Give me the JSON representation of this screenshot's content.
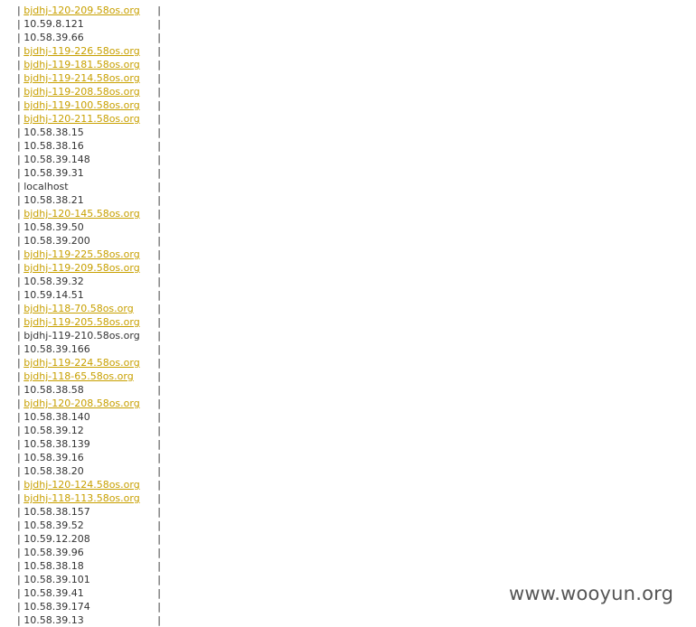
{
  "hosts": [
    {
      "name": "bjdhj-120-209.58os.org",
      "link": true
    },
    {
      "name": "10.59.8.121",
      "link": false
    },
    {
      "name": "10.58.39.66",
      "link": false
    },
    {
      "name": "bjdhj-119-226.58os.org",
      "link": true
    },
    {
      "name": "bjdhj-119-181.58os.org",
      "link": true
    },
    {
      "name": "bjdhj-119-214.58os.org",
      "link": true
    },
    {
      "name": "bjdhj-119-208.58os.org",
      "link": true
    },
    {
      "name": "bjdhj-119-100.58os.org",
      "link": true
    },
    {
      "name": "bjdhj-120-211.58os.org",
      "link": true
    },
    {
      "name": "10.58.38.15",
      "link": false
    },
    {
      "name": "10.58.38.16",
      "link": false
    },
    {
      "name": "10.58.39.148",
      "link": false
    },
    {
      "name": "10.58.39.31",
      "link": false
    },
    {
      "name": "localhost",
      "link": false
    },
    {
      "name": "10.58.38.21",
      "link": false
    },
    {
      "name": "bjdhj-120-145.58os.org",
      "link": true
    },
    {
      "name": "10.58.39.50",
      "link": false
    },
    {
      "name": "10.58.39.200",
      "link": false
    },
    {
      "name": "bjdhj-119-225.58os.org",
      "link": true
    },
    {
      "name": "bjdhj-119-209.58os.org",
      "link": true
    },
    {
      "name": "10.58.39.32",
      "link": false
    },
    {
      "name": "10.59.14.51",
      "link": false
    },
    {
      "name": "bjdhj-118-70.58os.org",
      "link": true
    },
    {
      "name": "bjdhj-119-205.58os.org",
      "link": true
    },
    {
      "name": "bjdhj-119-210.58os.org",
      "link": false
    },
    {
      "name": "10.58.39.166",
      "link": false
    },
    {
      "name": "bjdhj-119-224.58os.org",
      "link": true
    },
    {
      "name": "bjdhj-118-65.58os.org",
      "link": true
    },
    {
      "name": "10.58.38.58",
      "link": false
    },
    {
      "name": "bjdhj-120-208.58os.org",
      "link": true
    },
    {
      "name": "10.58.38.140",
      "link": false
    },
    {
      "name": "10.58.39.12",
      "link": false
    },
    {
      "name": "10.58.38.139",
      "link": false
    },
    {
      "name": "10.58.39.16",
      "link": false
    },
    {
      "name": "10.58.38.20",
      "link": false
    },
    {
      "name": "bjdhj-120-124.58os.org",
      "link": true
    },
    {
      "name": "bjdhj-118-113.58os.org",
      "link": true
    },
    {
      "name": "10.58.38.157",
      "link": false
    },
    {
      "name": "10.58.39.52",
      "link": false
    },
    {
      "name": "10.59.12.208",
      "link": false
    },
    {
      "name": "10.58.39.96",
      "link": false
    },
    {
      "name": "10.58.38.18",
      "link": false
    },
    {
      "name": "10.58.39.101",
      "link": false
    },
    {
      "name": "10.58.39.41",
      "link": false
    },
    {
      "name": "10.58.39.174",
      "link": false
    },
    {
      "name": "10.58.39.13",
      "link": false
    }
  ],
  "separator": "|",
  "watermark": "www.wooyun.org",
  "colors": {
    "link": "#c8a000",
    "text": "#333333",
    "watermark": "#555555"
  }
}
